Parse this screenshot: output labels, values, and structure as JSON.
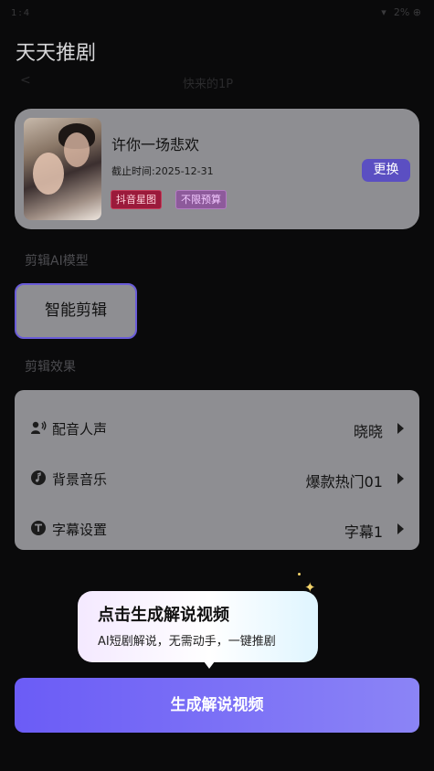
{
  "app": {
    "title": "天天推剧"
  },
  "status_bar": {
    "time": "1:4",
    "battery": "2% ⊕"
  },
  "nav_underlay": {
    "back": "<",
    "title": "快来的1P"
  },
  "drama": {
    "name": "许你一场悲欢",
    "deadline": "截止时间:2025-12-31",
    "tags": [
      "抖音星图",
      "不限预算"
    ],
    "change_label": "更换"
  },
  "model_section": {
    "label": "剪辑AI模型",
    "option": "智能剪辑"
  },
  "effects_section": {
    "label": "剪辑效果",
    "rows": [
      {
        "label": "配音人声",
        "value": "晓晓",
        "icon": "voice-icon"
      },
      {
        "label": "背景音乐",
        "value": "爆款热门01",
        "icon": "music-icon"
      },
      {
        "label": "字幕设置",
        "value": "字幕1",
        "icon": "subtitle-icon"
      }
    ]
  },
  "tooltip": {
    "title": "点击生成解说视频",
    "subtitle": "AI短剧解说，无需动手，一键推剧"
  },
  "generate_button": {
    "label": "生成解说视频"
  },
  "colors": {
    "accent": "#6b5cf6",
    "card": "#8e8e92",
    "background": "#0a0a0b"
  }
}
